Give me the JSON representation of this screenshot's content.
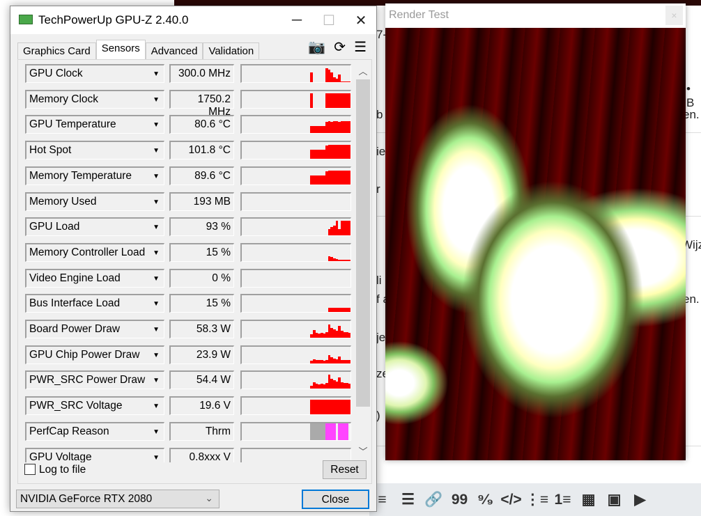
{
  "background": {
    "fragments": [
      "7-",
      "• B",
      "b",
      "en.",
      "ie",
      "r",
      "Wijzi",
      "li",
      "f a",
      "en.",
      "je",
      "ze",
      ")"
    ]
  },
  "editor_toolbar": {
    "icons": [
      "align-center-icon",
      "align-right-icon",
      "link-icon",
      "quote-icon",
      "spoiler-icon",
      "code-icon",
      "bullet-list-icon",
      "numbered-list-icon",
      "table-icon",
      "image-icon",
      "video-icon"
    ],
    "glyphs": [
      "≡",
      "☰",
      "🔗",
      "99",
      "⁹⁄₉",
      "</>",
      "⋮≡",
      "1≡",
      "▦",
      "▣",
      "▶"
    ]
  },
  "gpuz": {
    "title": "TechPowerUp GPU-Z 2.40.0",
    "tabs": [
      "Graphics Card",
      "Sensors",
      "Advanced",
      "Validation"
    ],
    "active_tab": "Sensors",
    "graph_color": "#ff0000",
    "sensors": [
      {
        "name": "GPU Clock",
        "value": "300.0 MHz",
        "history": [
          0.6,
          0,
          0,
          0,
          0,
          0,
          0.85,
          0.75,
          0.6,
          0.3,
          0.2,
          0.45,
          0.05,
          0.05,
          0.05,
          0.05
        ]
      },
      {
        "name": "Memory Clock",
        "value": "1750.2 MHz",
        "history": [
          0.85,
          0,
          0,
          0,
          0,
          0,
          0.85,
          0.85,
          0.85,
          0.85,
          0.85,
          0.85,
          0.85,
          0.85,
          0.85,
          0.85
        ]
      },
      {
        "name": "GPU Temperature",
        "value": "80.6 °C",
        "history": [
          0.45,
          0.45,
          0.45,
          0.45,
          0.45,
          0.45,
          0.7,
          0.72,
          0.7,
          0.72,
          0.72,
          0.7,
          0.72,
          0.72,
          0.72,
          0.72
        ]
      },
      {
        "name": "Hot Spot",
        "value": "101.8 °C",
        "history": [
          0.55,
          0.55,
          0.55,
          0.55,
          0.55,
          0.55,
          0.8,
          0.85,
          0.85,
          0.85,
          0.85,
          0.82,
          0.85,
          0.85,
          0.85,
          0.85
        ]
      },
      {
        "name": "Memory Temperature",
        "value": "89.6 °C",
        "history": [
          0.55,
          0.52,
          0.52,
          0.52,
          0.52,
          0.52,
          0.78,
          0.82,
          0.82,
          0.82,
          0.82,
          0.82,
          0.82,
          0.84,
          0.84,
          0.84
        ]
      },
      {
        "name": "Memory Used",
        "value": "193 MB",
        "history": []
      },
      {
        "name": "GPU Load",
        "value": "93 %",
        "history": [
          0,
          0,
          0,
          0,
          0,
          0,
          0,
          0.4,
          0.5,
          0.6,
          0.9,
          0.4,
          0.9,
          0.9,
          0.9,
          0.9
        ]
      },
      {
        "name": "Memory Controller Load",
        "value": "15 %",
        "history": [
          0,
          0,
          0,
          0,
          0,
          0,
          0,
          0.3,
          0.25,
          0.15,
          0.12,
          0.1,
          0.1,
          0.1,
          0.1,
          0.1
        ]
      },
      {
        "name": "Video Engine Load",
        "value": "0 %",
        "history": []
      },
      {
        "name": "Bus Interface Load",
        "value": "15 %",
        "history": [
          0,
          0,
          0,
          0,
          0,
          0,
          0,
          0.25,
          0.25,
          0.25,
          0.25,
          0.25,
          0.25,
          0.25,
          0.25,
          0.25
        ]
      },
      {
        "name": "Board Power Draw",
        "value": "58.3 W",
        "history": [
          0.2,
          0.45,
          0.3,
          0.25,
          0.3,
          0.25,
          0.35,
          0.8,
          0.6,
          0.5,
          0.4,
          0.7,
          0.4,
          0.35,
          0.35,
          0.3
        ]
      },
      {
        "name": "GPU Chip Power Draw",
        "value": "23.9 W",
        "history": [
          0.15,
          0.25,
          0.2,
          0.2,
          0.2,
          0.15,
          0.2,
          0.5,
          0.35,
          0.3,
          0.25,
          0.4,
          0.2,
          0.2,
          0.2,
          0.2
        ]
      },
      {
        "name": "PWR_SRC Power Draw",
        "value": "54.4 W",
        "history": [
          0.2,
          0.4,
          0.3,
          0.25,
          0.3,
          0.25,
          0.35,
          0.85,
          0.6,
          0.5,
          0.45,
          0.7,
          0.4,
          0.35,
          0.35,
          0.3
        ]
      },
      {
        "name": "PWR_SRC Voltage",
        "value": "19.6 V",
        "history": [
          0.9,
          0.9,
          0.9,
          0.9,
          0.9,
          0.9,
          0.9,
          0.9,
          0.9,
          0.9,
          0.9,
          0.9,
          0.9,
          0.9,
          0.9,
          0.9
        ]
      },
      {
        "name": "PerfCap Reason",
        "value": "Thrm",
        "history": [
          1,
          1,
          1,
          1,
          1,
          1,
          1,
          1,
          1,
          1,
          0,
          1,
          1,
          1,
          1,
          0
        ],
        "colors": [
          "#aaaaaa",
          "#aaaaaa",
          "#aaaaaa",
          "#aaaaaa",
          "#aaaaaa",
          "#aaaaaa",
          "#ff44ff",
          "#ff44ff",
          "#ff44ff",
          "#ff44ff",
          "#ff44ff",
          "#ff44ff",
          "#ff44ff",
          "#ff44ff",
          "#ff44ff",
          "#ff44ff"
        ]
      },
      {
        "name": "GPU Voltage",
        "value": "0.8xxx V",
        "history": []
      }
    ],
    "log_to_file": {
      "label": "Log to file",
      "checked": false
    },
    "reset_label": "Reset",
    "gpu_select": "NVIDIA GeForce RTX 2080",
    "close_label": "Close"
  },
  "render_test": {
    "title": "Render Test",
    "close_glyph": "×"
  }
}
